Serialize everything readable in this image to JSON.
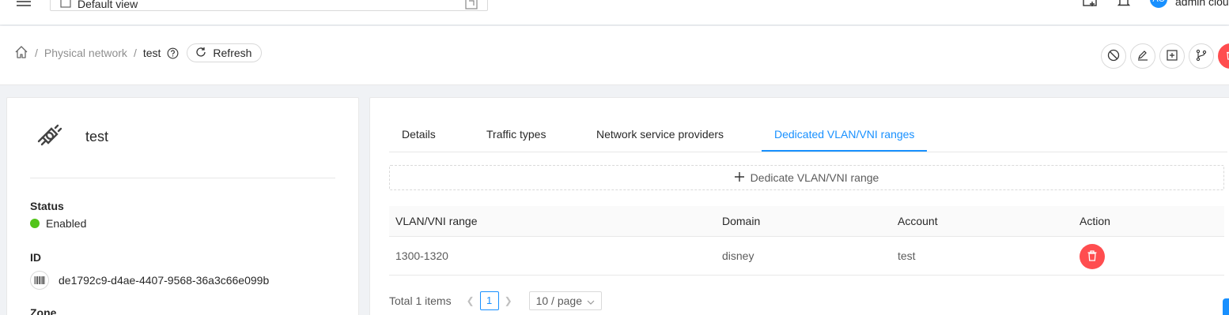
{
  "header": {
    "view_select_value": "Default view",
    "user_initials": "AC",
    "user_name": "admin cloud"
  },
  "breadcrumb": {
    "items": [
      "Physical network",
      "test"
    ],
    "refresh_label": "Refresh"
  },
  "actions": [
    "disable",
    "edit",
    "add",
    "branch",
    "delete"
  ],
  "resource": {
    "name": "test",
    "status_label": "Status",
    "status_value": "Enabled",
    "id_label": "ID",
    "id_value": "de1792c9-d4ae-4407-9568-36a3c66e099b",
    "zone_label": "Zone"
  },
  "tabs": [
    {
      "label": "Details",
      "active": false
    },
    {
      "label": "Traffic types",
      "active": false
    },
    {
      "label": "Network service providers",
      "active": false
    },
    {
      "label": "Dedicated VLAN/VNI ranges",
      "active": true
    }
  ],
  "dedicate_button_label": "Dedicate VLAN/VNI range",
  "table": {
    "columns": [
      "VLAN/VNI range",
      "Domain",
      "Account",
      "Action"
    ],
    "rows": [
      {
        "range": "1300-1320",
        "domain": "disney",
        "account": "test"
      }
    ]
  },
  "pagination": {
    "total_text": "Total 1 items",
    "current_page": "1",
    "page_size": "10 / page"
  },
  "colors": {
    "primary": "#1890ff",
    "danger": "#ff4d4f",
    "success": "#52c41a"
  }
}
